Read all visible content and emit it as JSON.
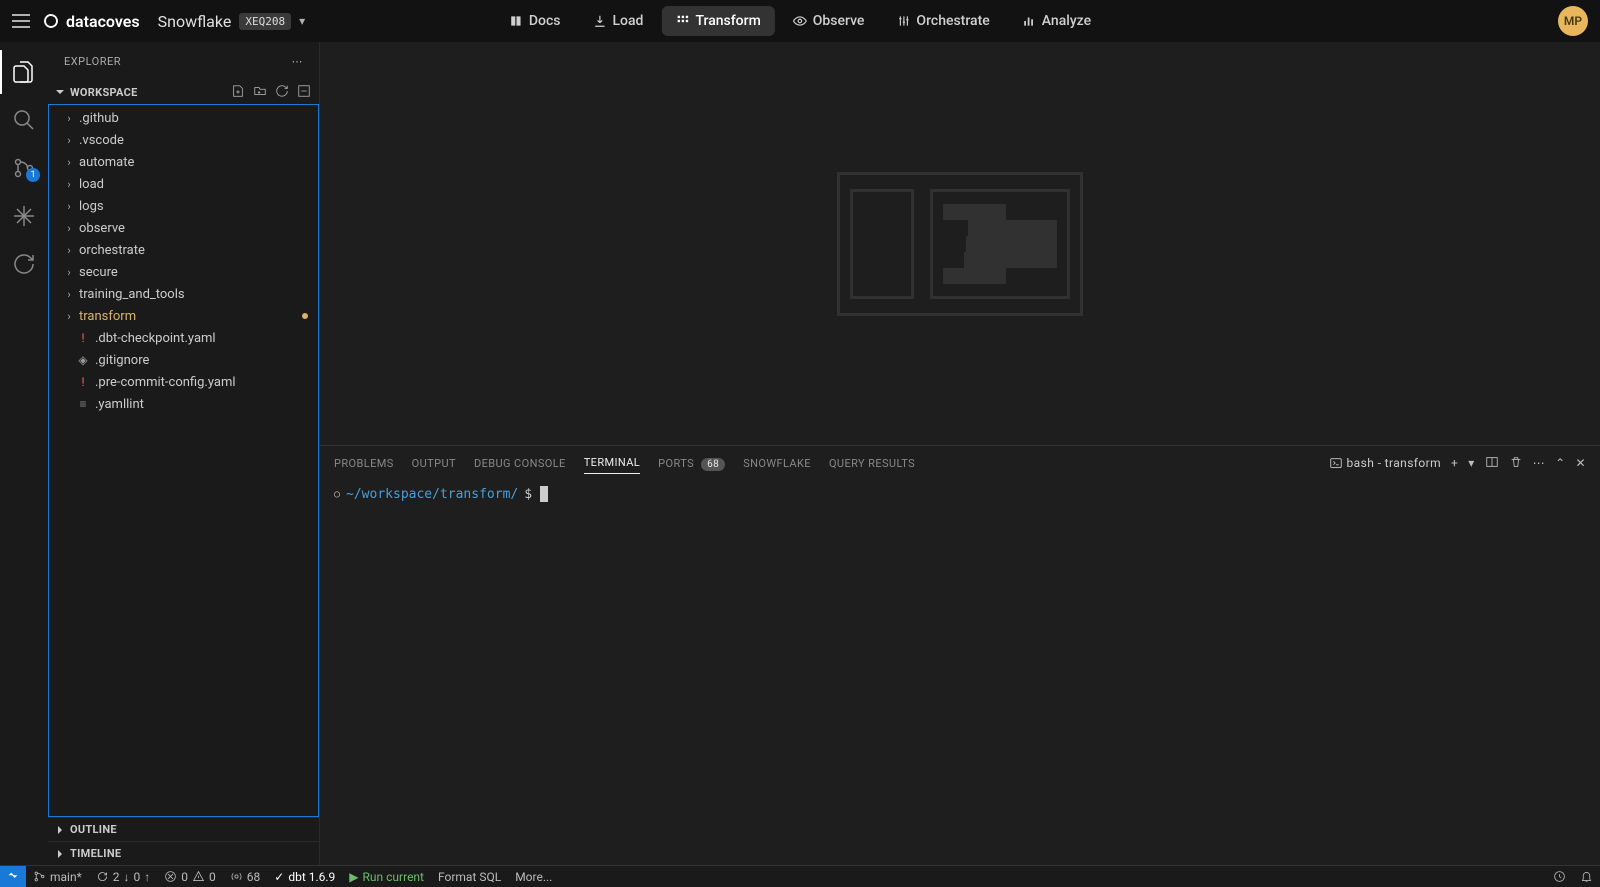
{
  "header": {
    "brand": "datacoves",
    "project_name": "Snowflake",
    "project_badge": "XEQ208",
    "nav": [
      {
        "label": "Docs",
        "icon": "book"
      },
      {
        "label": "Load",
        "icon": "download"
      },
      {
        "label": "Transform",
        "icon": "grid",
        "active": true
      },
      {
        "label": "Observe",
        "icon": "eye"
      },
      {
        "label": "Orchestrate",
        "icon": "sliders"
      },
      {
        "label": "Analyze",
        "icon": "bar"
      }
    ],
    "avatar_initials": "MP"
  },
  "activitybar": {
    "items": [
      {
        "name": "explorer",
        "icon": "files",
        "active": true
      },
      {
        "name": "search",
        "icon": "search"
      },
      {
        "name": "source-control",
        "icon": "branch",
        "badge": "1"
      },
      {
        "name": "snowflake",
        "icon": "snowflake"
      },
      {
        "name": "refresh",
        "icon": "refresh"
      }
    ]
  },
  "sidebar": {
    "title": "EXPLORER",
    "workspace_label": "WORKSPACE",
    "tree": [
      {
        "type": "folder",
        "label": ".github"
      },
      {
        "type": "folder",
        "label": ".vscode"
      },
      {
        "type": "folder",
        "label": "automate"
      },
      {
        "type": "folder",
        "label": "load"
      },
      {
        "type": "folder",
        "label": "logs"
      },
      {
        "type": "folder",
        "label": "observe"
      },
      {
        "type": "folder",
        "label": "orchestrate"
      },
      {
        "type": "folder",
        "label": "secure"
      },
      {
        "type": "folder",
        "label": "training_and_tools"
      },
      {
        "type": "folder",
        "label": "transform",
        "modified": true
      },
      {
        "type": "file",
        "label": ".dbt-checkpoint.yaml",
        "icon": "yaml"
      },
      {
        "type": "file",
        "label": ".gitignore",
        "icon": "git"
      },
      {
        "type": "file",
        "label": ".pre-commit-config.yaml",
        "icon": "yaml"
      },
      {
        "type": "file",
        "label": ".yamllint",
        "icon": "text"
      }
    ],
    "sections": [
      {
        "label": "OUTLINE"
      },
      {
        "label": "TIMELINE"
      }
    ]
  },
  "panel": {
    "tabs": [
      {
        "label": "PROBLEMS"
      },
      {
        "label": "OUTPUT"
      },
      {
        "label": "DEBUG CONSOLE"
      },
      {
        "label": "TERMINAL",
        "active": true
      },
      {
        "label": "PORTS",
        "badge": "68"
      },
      {
        "label": "SNOWFLAKE"
      },
      {
        "label": "QUERY RESULTS"
      }
    ],
    "shell_label": "bash - transform",
    "terminal": {
      "path": "~/workspace/transform/",
      "prompt": "$"
    }
  },
  "statusbar": {
    "branch": "main*",
    "sync_out": "2",
    "sync_in": "0",
    "errors": "0",
    "warnings": "0",
    "ports": "68",
    "dbt_version": "dbt 1.6.9",
    "run_current": "Run current",
    "format_sql": "Format SQL",
    "more": "More..."
  }
}
